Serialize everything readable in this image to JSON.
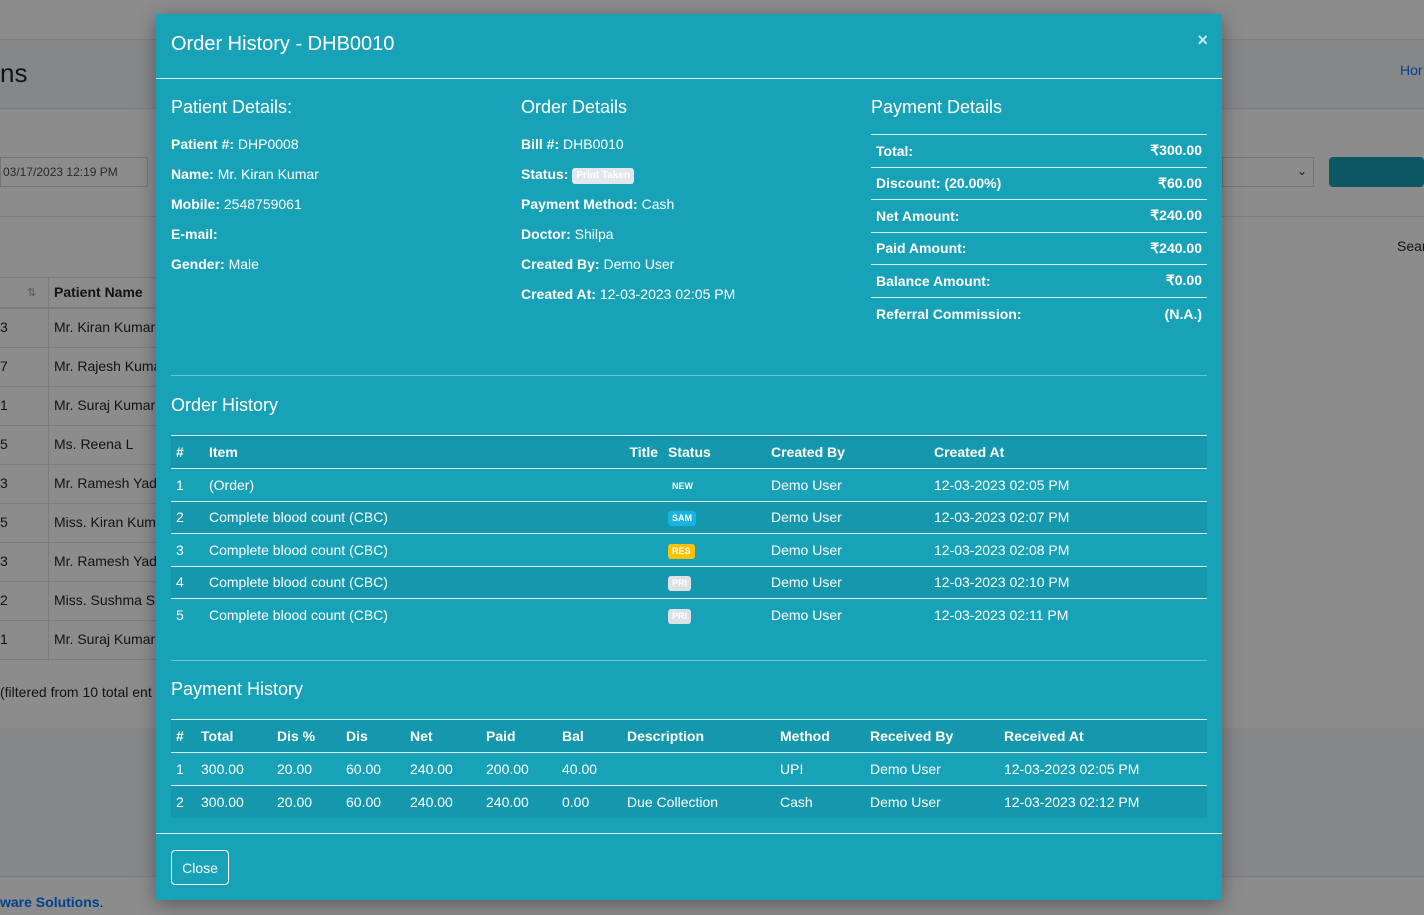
{
  "background": {
    "page_title": "ns",
    "crumb": "Hor",
    "date_value": "03/17/2023 12:19 PM",
    "search_label": "Sear",
    "table_header": "Patient Name",
    "rows": [
      {
        "num": "3",
        "name": "Mr. Kiran Kumar"
      },
      {
        "num": "7",
        "name": "Mr. Rajesh Kuma"
      },
      {
        "num": "1",
        "name": "Mr. Suraj Kumar"
      },
      {
        "num": "5",
        "name": "Ms. Reena L"
      },
      {
        "num": "3",
        "name": "Mr. Ramesh Yada"
      },
      {
        "num": "5",
        "name": "Miss. Kiran Kuma"
      },
      {
        "num": "3",
        "name": "Mr. Ramesh Yada"
      },
      {
        "num": "2",
        "name": "Miss. Sushma Sir"
      },
      {
        "num": "1",
        "name": "Mr. Suraj Kumar"
      }
    ],
    "info": "(filtered from 10 total ent",
    "footer_text": "ware Solutions"
  },
  "modal": {
    "title": "Order History - DHB0010",
    "close_symbol": "×",
    "patient": {
      "heading": "Patient Details:",
      "fields": [
        {
          "label": "Patient #:",
          "value": "DHP0008"
        },
        {
          "label": "Name:",
          "value": "Mr. Kiran Kumar"
        },
        {
          "label": "Mobile:",
          "value": "2548759061"
        },
        {
          "label": "E-mail:",
          "value": ""
        },
        {
          "label": "Gender:",
          "value": "Male"
        }
      ]
    },
    "order": {
      "heading": "Order Details",
      "bill_label": "Bill #:",
      "bill_value": "DHB0010",
      "status_label": "Status:",
      "status_badge": "Print Taken",
      "method_label": "Payment Method:",
      "method_value": "Cash",
      "doctor_label": "Doctor:",
      "doctor_value": "Shilpa",
      "created_by_label": "Created By:",
      "created_by_value": "Demo User",
      "created_at_label": "Created At:",
      "created_at_value": "12-03-2023 02:05 PM"
    },
    "payment": {
      "heading": "Payment Details",
      "rows": [
        {
          "label": "Total:",
          "value": "₹300.00"
        },
        {
          "label": "Discount: (20.00%)",
          "value": "₹60.00"
        },
        {
          "label": "Net Amount:",
          "value": "₹240.00"
        },
        {
          "label": "Paid Amount:",
          "value": "₹240.00"
        },
        {
          "label": "Balance Amount:",
          "value": "₹0.00"
        },
        {
          "label": "Referral Commission:",
          "value": "(N.A.)"
        }
      ]
    },
    "order_history": {
      "heading": "Order History",
      "columns": [
        "#",
        "Item",
        "Title",
        "Status",
        "Created By",
        "Created At"
      ],
      "rows": [
        {
          "num": "1",
          "item": "(Order)",
          "title": "",
          "status": "NEW",
          "status_kind": "new",
          "by": "Demo User",
          "at": "12-03-2023 02:05 PM"
        },
        {
          "num": "2",
          "item": "Complete blood count (CBC)",
          "title": "",
          "status": "SAM",
          "status_kind": "sam",
          "by": "Demo User",
          "at": "12-03-2023 02:07 PM"
        },
        {
          "num": "3",
          "item": "Complete blood count (CBC)",
          "title": "",
          "status": "RES",
          "status_kind": "res",
          "by": "Demo User",
          "at": "12-03-2023 02:08 PM"
        },
        {
          "num": "4",
          "item": "Complete blood count (CBC)",
          "title": "",
          "status": "PRI",
          "status_kind": "pri",
          "by": "Demo User",
          "at": "12-03-2023 02:10 PM"
        },
        {
          "num": "5",
          "item": "Complete blood count (CBC)",
          "title": "",
          "status": "PRI",
          "status_kind": "pri",
          "by": "Demo User",
          "at": "12-03-2023 02:11 PM"
        }
      ]
    },
    "payment_history": {
      "heading": "Payment History",
      "columns": [
        "#",
        "Total",
        "Dis %",
        "Dis",
        "Net",
        "Paid",
        "Bal",
        "Description",
        "Method",
        "Received By",
        "Received At"
      ],
      "rows": [
        {
          "num": "1",
          "total": "300.00",
          "dis_pct": "20.00",
          "dis": "60.00",
          "net": "240.00",
          "paid": "200.00",
          "bal": "40.00",
          "desc": "",
          "method": "UPI",
          "by": "Demo User",
          "at": "12-03-2023 02:05 PM"
        },
        {
          "num": "2",
          "total": "300.00",
          "dis_pct": "20.00",
          "dis": "60.00",
          "net": "240.00",
          "paid": "240.00",
          "bal": "0.00",
          "desc": "Due Collection",
          "method": "Cash",
          "by": "Demo User",
          "at": "12-03-2023 02:12 PM"
        }
      ]
    },
    "close_button": "Close"
  }
}
